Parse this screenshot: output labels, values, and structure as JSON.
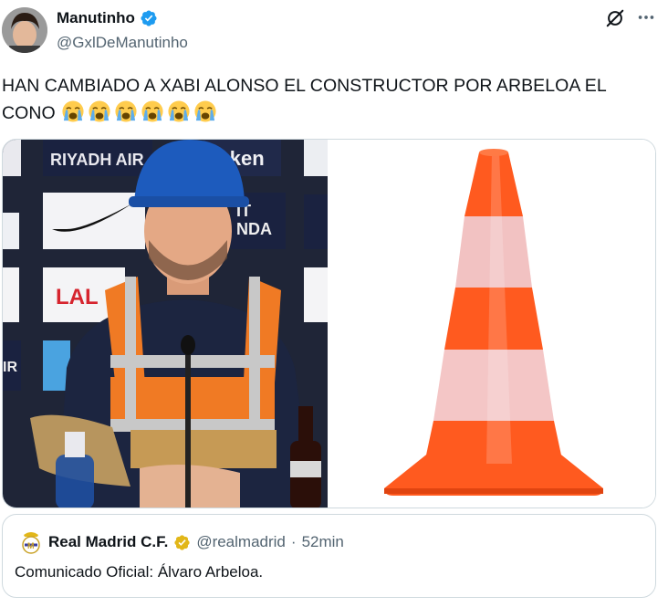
{
  "author": {
    "display_name": "Manutinho",
    "handle": "@GxlDeManutinho",
    "verified_icon": "verified-badge-icon",
    "colors": {
      "verified": "#1d9bf0"
    }
  },
  "header_icons": {
    "grok": "grok-icon",
    "more": "more-options-icon"
  },
  "tweet": {
    "text": "HAN CAMBIADO A XABI ALONSO EL CONSTRUCTOR POR ARBELOA EL CONO",
    "emoji": [
      "loudly-crying-face",
      "loudly-crying-face",
      "loudly-crying-face",
      "loudly-crying-face",
      "loudly-crying-face",
      "loudly-crying-face"
    ]
  },
  "media": {
    "left": {
      "sponsor_texts": [
        "RIYADH AIR",
        "raken",
        "IT",
        "NDA",
        "LAL",
        "IR"
      ]
    },
    "right": {}
  },
  "quoted": {
    "display_name": "Real Madrid C.F.",
    "handle": "@realmadrid",
    "separator": "·",
    "time": "52min",
    "text": "Comunicado Oficial: Álvaro Arbeloa.",
    "colors": {
      "gold_badge": "#e2b719"
    }
  }
}
